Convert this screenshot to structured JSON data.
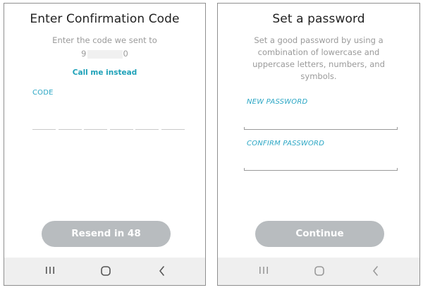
{
  "left_screen": {
    "title": "Enter Confirmation Code",
    "subtitle": "Enter the code we sent to",
    "phone_prefix": "9",
    "phone_suffix": "0",
    "call_link": "Call me instead",
    "code_label": "CODE",
    "resend_button": "Resend in 48"
  },
  "right_screen": {
    "title": "Set a password",
    "description": [
      "Set a good password by using a",
      "combination of lowercase and",
      "uppercase letters, numbers, and",
      "symbols."
    ],
    "new_password_label": "NEW PASSWORD",
    "confirm_password_label": "CONFIRM PASSWORD",
    "continue_button": "Continue"
  },
  "navbar": {
    "icons": [
      "recents-icon",
      "home-icon",
      "back-icon"
    ]
  },
  "colors": {
    "accent": "#2aa6c4",
    "button_disabled": "#b8bcbf",
    "nav_bg": "#efefef"
  }
}
